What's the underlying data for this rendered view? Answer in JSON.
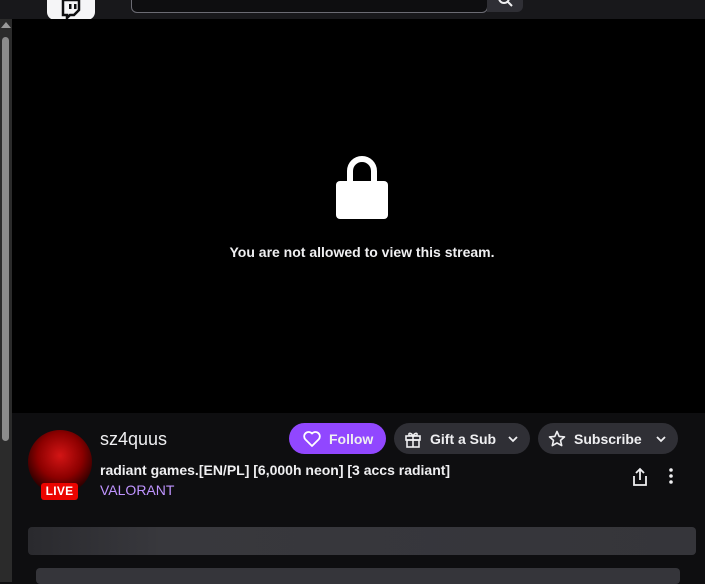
{
  "player": {
    "message": "You are not allowed to view this stream."
  },
  "channel": {
    "name": "sz4quus",
    "live_badge": "LIVE",
    "stream_title": "radiant games.[EN/PL] [6,000h neon] [3 accs radiant]",
    "game": "VALORANT"
  },
  "actions": {
    "follow": "Follow",
    "gift": "Gift a Sub",
    "subscribe": "Subscribe"
  },
  "colors": {
    "accent": "#9147ff",
    "live": "#eb0400",
    "game_link": "#bf94ff"
  }
}
